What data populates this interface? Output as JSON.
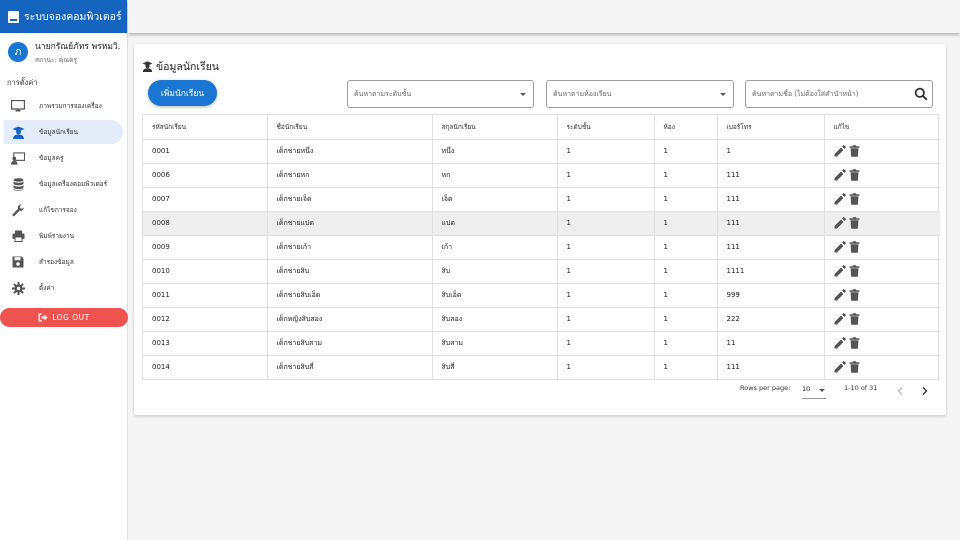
{
  "app": {
    "title": "ระบบจองคอมพิวเตอร์"
  },
  "user": {
    "initial": "ภ",
    "name": "นายกรัณย์ภัทร พรหมวิ...",
    "status": "สถานะ: คุณครู"
  },
  "sidebar": {
    "heading": "การตั้งค่า",
    "items": [
      {
        "label": "ภาพรวมการจองเครื่อง",
        "icon": "monitor-icon"
      },
      {
        "label": "ข้อมูลนักเรียน",
        "icon": "student-icon"
      },
      {
        "label": "ข้อมูลครู",
        "icon": "teacher-icon"
      },
      {
        "label": "ข้อมูลเครื่องคอมพิวเตอร์",
        "icon": "database-icon"
      },
      {
        "label": "แก้ไขการจอง",
        "icon": "wrench-icon"
      },
      {
        "label": "พิมพ์รายงาน",
        "icon": "printer-icon"
      },
      {
        "label": "สำรองข้อมูล",
        "icon": "floppy-icon"
      },
      {
        "label": "ตั้งค่า",
        "icon": "gear-icon"
      }
    ],
    "logout_label": "LOG OUT"
  },
  "page": {
    "title": "ข้อมูลนักเรียน",
    "add_button": "เพิ่มนักเรียน",
    "filters": {
      "level_placeholder": "ค้นหาตามระดับชั้น",
      "room_placeholder": "ค้นหาตามห้องเรียน",
      "name_placeholder": "ค้นหาตามชื่อ (ไม่ต้องใส่คำนำหน้า)"
    }
  },
  "table": {
    "columns": [
      "รหัสนักเรียน",
      "ชื่อนักเรียน",
      "สกุลนักเรียน",
      "ระดับชั้น",
      "ห้อง",
      "เบอร์โทร",
      "แก้ไข"
    ],
    "rows": [
      [
        "0001",
        "เด็กชายหนึ่ง",
        "หนึ่ง",
        "1",
        "1",
        "1"
      ],
      [
        "0006",
        "เด็กชายหก",
        "หก",
        "1",
        "1",
        "111"
      ],
      [
        "0007",
        "เด็กชายเจ็ด",
        "เจ็ด",
        "1",
        "1",
        "111"
      ],
      [
        "0008",
        "เด็กชายแปด",
        "แปด",
        "1",
        "1",
        "111"
      ],
      [
        "0009",
        "เด็กชายเก้า",
        "เก้า",
        "1",
        "1",
        "111"
      ],
      [
        "0010",
        "เด็กชายสิบ",
        "สิบ",
        "1",
        "1",
        "1111"
      ],
      [
        "0011",
        "เด็กชายสิบเอ็ด",
        "สิบเอ็ด",
        "1",
        "1",
        "999"
      ],
      [
        "0012",
        "เด็กหญิงสิบสอง",
        "สิบสอง",
        "1",
        "1",
        "222"
      ],
      [
        "0013",
        "เด็กชายสิบสาม",
        "สิบสาม",
        "1",
        "1",
        "11"
      ],
      [
        "0014",
        "เด็กชายสิบสี่",
        "สิบสี่",
        "1",
        "1",
        "111"
      ]
    ],
    "highlighted_row": 3
  },
  "pagination": {
    "rows_per_page_label": "Rows per page:",
    "rows_per_page": "10",
    "range": "1-10 of 31"
  },
  "colors": {
    "primary": "#1565c0",
    "button": "#1976d2",
    "logout": "#ef5350",
    "active_item": "#e3edf9"
  }
}
